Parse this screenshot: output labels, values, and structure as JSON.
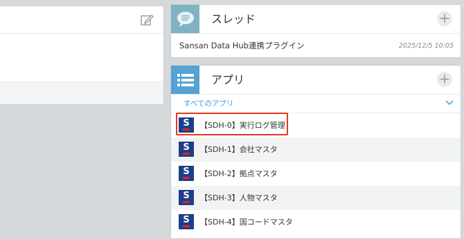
{
  "thread_widget": {
    "title": "スレッド",
    "icon": "speech-bubble-icon",
    "add_label": "+",
    "thread": {
      "name": "Sansan Data Hub連携プラグイン",
      "time": "2025/12/5 10:05"
    }
  },
  "app_widget": {
    "title": "アプリ",
    "icon": "list-icon",
    "add_label": "+",
    "filter_label": "すべてのアプリ",
    "apps": [
      {
        "name": "【SDH-0】実行ログ管理",
        "logo": "S",
        "highlighted": true
      },
      {
        "name": "【SDH-1】会社マスタ",
        "logo": "S"
      },
      {
        "name": "【SDH-2】拠点マスタ",
        "logo": "S"
      },
      {
        "name": "【SDH-3】人物マスタ",
        "logo": "S"
      },
      {
        "name": "【SDH-4】国コードマスタ",
        "logo": "S"
      }
    ]
  },
  "colors": {
    "highlight": "#e8341c",
    "link": "#3a9ad9",
    "app_logo": "#1c3f8a"
  }
}
